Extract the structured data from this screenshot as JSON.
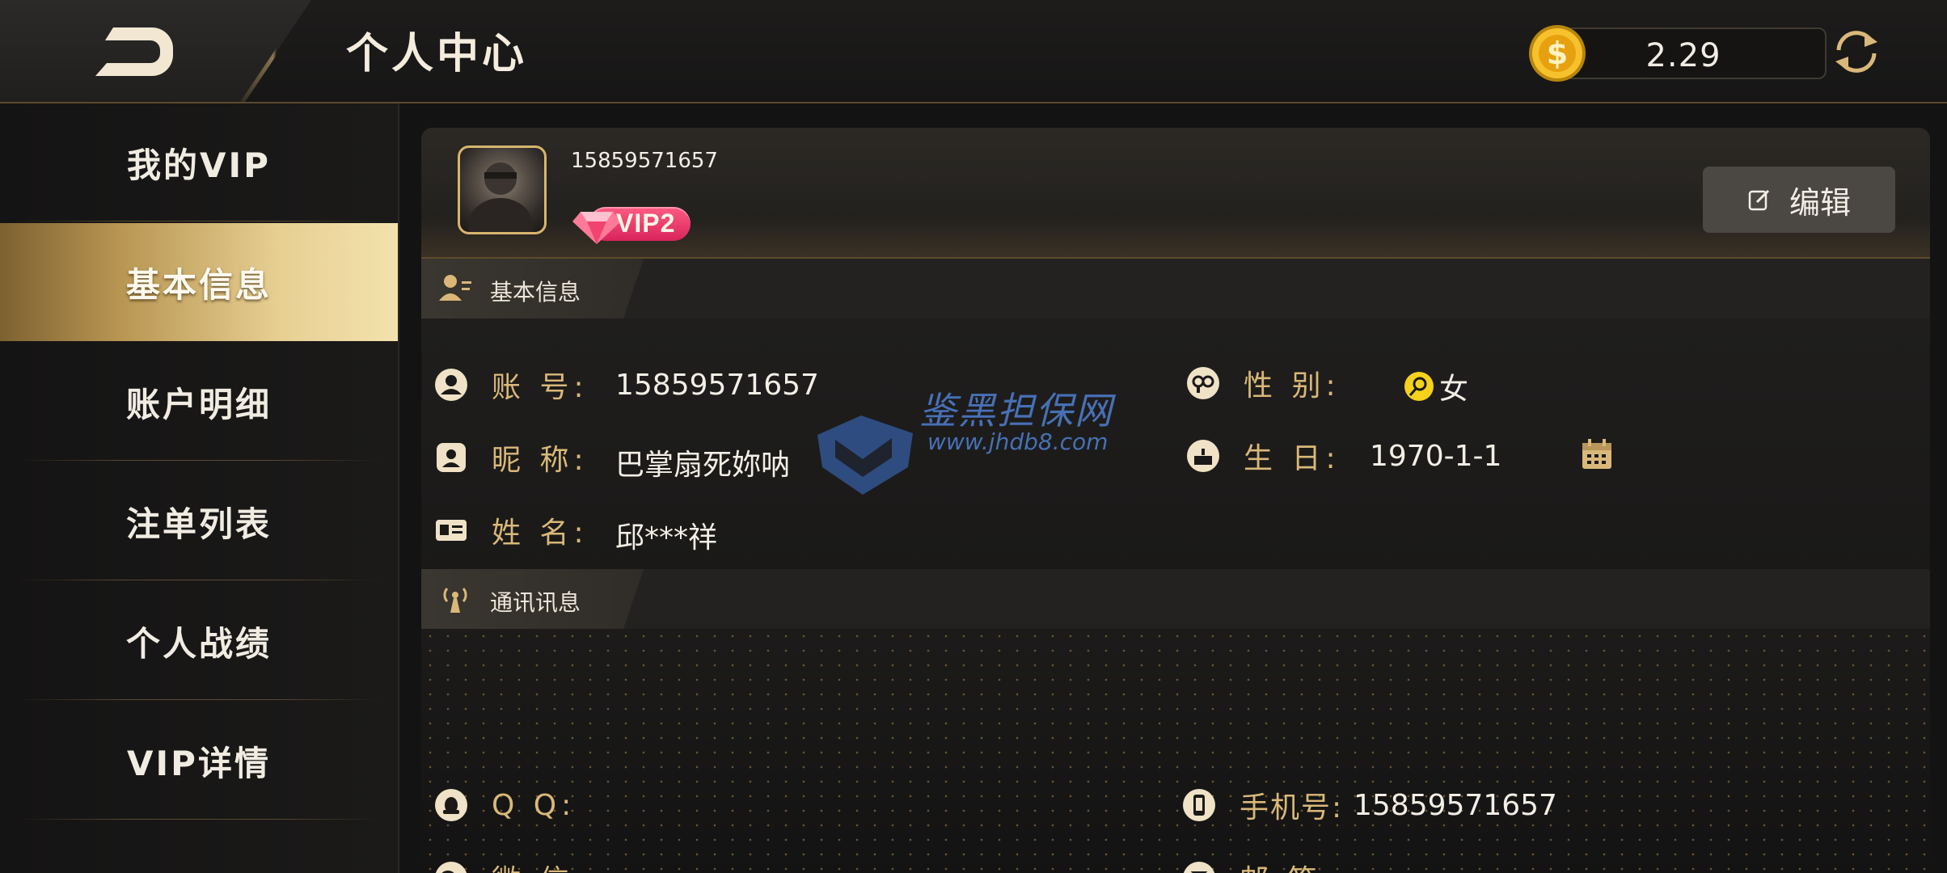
{
  "header": {
    "title": "个人中心",
    "balance": "2.29"
  },
  "sidebar": {
    "items": [
      {
        "label": "我的VIP",
        "active": false
      },
      {
        "label": "基本信息",
        "active": true
      },
      {
        "label": "账户明细",
        "active": false
      },
      {
        "label": "注单列表",
        "active": false
      },
      {
        "label": "个人战绩",
        "active": false
      },
      {
        "label": "VIP详情",
        "active": false
      }
    ]
  },
  "profile": {
    "phone": "15859571657",
    "vip_badge": "VIP2",
    "edit_label": "编辑"
  },
  "basic_info": {
    "section_title": "基本信息",
    "account_label": "账 号:",
    "account_value": "15859571657",
    "nickname_label": "昵 称:",
    "nickname_value": "巴掌扇死妳呐",
    "name_label": "姓 名:",
    "name_value": "邱***祥",
    "gender_label": "性 别:",
    "gender_value": "女",
    "birthday_label": "生 日:",
    "birthday_value": "1970-1-1"
  },
  "contact_info": {
    "section_title": "通讯讯息",
    "qq_label": "Q Q:",
    "qq_value": "",
    "wechat_label": "微 信:",
    "wechat_value": "",
    "mobile_label": "手机号:",
    "mobile_value": "15859571657",
    "email_label": "邮 箱:",
    "email_value": ""
  },
  "watermark": {
    "title": "鉴黑担保网",
    "url": "www.jhdb8.com"
  },
  "colors": {
    "gold": "#d9b879",
    "active_tab_gradient_end": "#f3e2ad",
    "vip_pink": "#e8366a"
  }
}
